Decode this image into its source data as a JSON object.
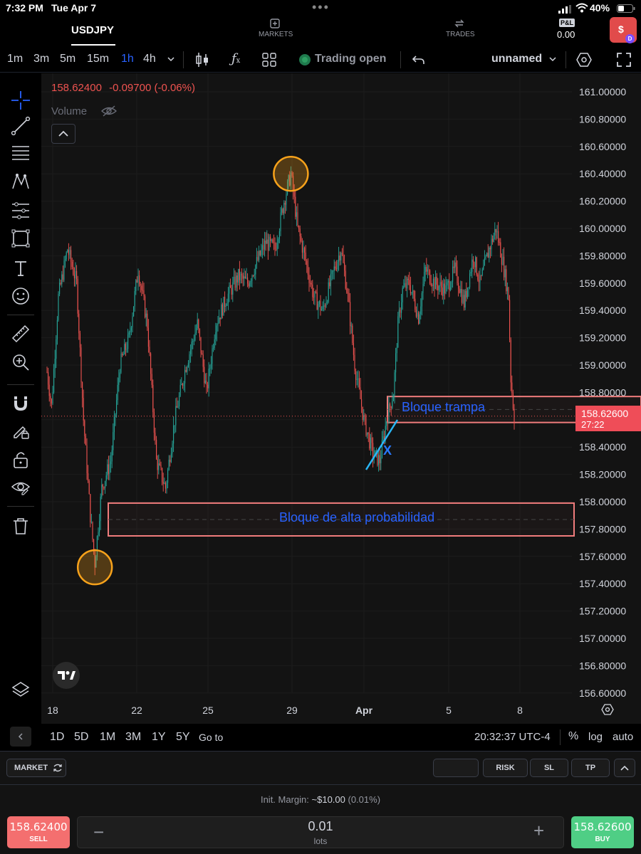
{
  "status_bar": {
    "time": "7:32 PM",
    "date": "Tue Apr 7",
    "battery": "40%"
  },
  "header": {
    "symbol": "USDJPY",
    "markets_label": "MARKETS",
    "trades_label": "TRADES",
    "pnl_label": "P&L",
    "pnl_value": "0.00",
    "account_badge": "D"
  },
  "toolbar": {
    "timeframes": [
      "1m",
      "3m",
      "5m",
      "15m",
      "1h",
      "4h"
    ],
    "active_timeframe": "1h",
    "trading_status": "Trading open",
    "layout_name": "unnamed"
  },
  "legend": {
    "price": "158.62400",
    "change": "-0.09700 (-0.06%)",
    "volume_label": "Volume"
  },
  "chart_data": {
    "type": "candlestick",
    "symbol": "USDJPY",
    "interval": "1h",
    "ylim": [
      156.5,
      161.1
    ],
    "y_ticks": [
      "161.00000",
      "160.80000",
      "160.60000",
      "160.40000",
      "160.20000",
      "160.00000",
      "159.80000",
      "159.60000",
      "159.40000",
      "159.20000",
      "159.00000",
      "158.80000",
      "158.60000",
      "158.40000",
      "158.20000",
      "158.00000",
      "157.80000",
      "157.60000",
      "157.40000",
      "157.20000",
      "157.00000",
      "156.80000",
      "156.60000"
    ],
    "x_ticks": [
      "18",
      "22",
      "25",
      "29",
      "Apr",
      "5",
      "8"
    ],
    "price_path": [
      [
        0,
        158.95
      ],
      [
        4,
        158.7
      ],
      [
        10,
        159.5
      ],
      [
        18,
        159.85
      ],
      [
        26,
        159.6
      ],
      [
        32,
        158.6
      ],
      [
        38,
        157.9
      ],
      [
        42,
        157.55
      ],
      [
        48,
        158.1
      ],
      [
        56,
        158.3
      ],
      [
        64,
        159.0
      ],
      [
        72,
        159.2
      ],
      [
        80,
        159.7
      ],
      [
        88,
        159.3
      ],
      [
        96,
        158.3
      ],
      [
        104,
        158.1
      ],
      [
        112,
        158.6
      ],
      [
        122,
        159.0
      ],
      [
        132,
        159.3
      ],
      [
        140,
        158.8
      ],
      [
        148,
        159.3
      ],
      [
        158,
        159.5
      ],
      [
        168,
        159.65
      ],
      [
        176,
        159.6
      ],
      [
        184,
        159.75
      ],
      [
        192,
        159.9
      ],
      [
        200,
        159.85
      ],
      [
        208,
        160.2
      ],
      [
        214,
        160.4
      ],
      [
        220,
        160.0
      ],
      [
        226,
        159.8
      ],
      [
        234,
        159.5
      ],
      [
        242,
        159.4
      ],
      [
        252,
        159.7
      ],
      [
        258,
        159.85
      ],
      [
        264,
        159.5
      ],
      [
        270,
        159.0
      ],
      [
        278,
        158.6
      ],
      [
        286,
        158.35
      ],
      [
        292,
        158.3
      ],
      [
        298,
        158.6
      ],
      [
        304,
        158.8
      ],
      [
        308,
        159.3
      ],
      [
        312,
        159.55
      ],
      [
        318,
        159.6
      ],
      [
        326,
        159.35
      ],
      [
        332,
        159.7
      ],
      [
        340,
        159.6
      ],
      [
        350,
        159.55
      ],
      [
        358,
        159.7
      ],
      [
        366,
        159.45
      ],
      [
        374,
        159.8
      ],
      [
        380,
        159.6
      ],
      [
        388,
        159.85
      ],
      [
        394,
        160.0
      ],
      [
        400,
        159.75
      ],
      [
        405,
        159.5
      ],
      [
        407,
        158.9
      ],
      [
        410,
        158.62
      ]
    ],
    "current_price": "158.62600",
    "countdown": "27:22",
    "zones": [
      {
        "label": "Bloque trampa",
        "top": 158.77,
        "bottom": 158.58
      },
      {
        "label": "Bloque de alta probabilidad",
        "top": 157.99,
        "bottom": 157.75
      }
    ],
    "markers": [
      {
        "type": "circle",
        "price": 160.4,
        "index": 214
      },
      {
        "type": "circle",
        "price": 157.52,
        "index": 42
      }
    ],
    "annotations": [
      {
        "text": "X"
      }
    ],
    "colors": {
      "up": "#26a69a",
      "down": "#ef5350",
      "zone": "#f07c7c",
      "label": "#2962ff",
      "marker": "#f7a21b",
      "trendline": "#29b6f6"
    }
  },
  "bottom_bar": {
    "ranges": [
      "1D",
      "5D",
      "1M",
      "3M",
      "1Y",
      "5Y"
    ],
    "goto_label": "Go to",
    "clock": "20:32:37 UTC-4",
    "percent_label": "%",
    "log_label": "log",
    "auto_label": "auto"
  },
  "trade_panel": {
    "order_type": "MARKET",
    "risk_label": "RISK",
    "sl_label": "SL",
    "tp_label": "TP",
    "margin_label": "Init. Margin:",
    "margin_value": "~$10.00",
    "margin_pct": "(0.01%)",
    "sell_price": "158.62400",
    "sell_label": "SELL",
    "quantity": "0.01",
    "quantity_unit": "lots",
    "buy_price": "158.62600",
    "buy_label": "BUY",
    "colors": {
      "sell": "#f46f6f",
      "buy": "#4fce85"
    }
  }
}
